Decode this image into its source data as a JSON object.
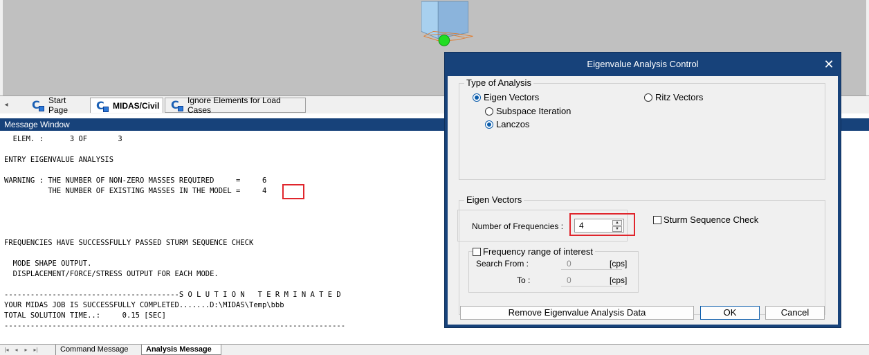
{
  "dialog": {
    "title": "Eigenvalue Analysis Control",
    "type_group_label": "Type of Analysis",
    "eigen_vectors_label": "Eigen Vectors",
    "ritz_vectors_label": "Ritz Vectors",
    "subspace_label": "Subspace Iteration",
    "lanczos_label": "Lanczos",
    "eigen_group_label": "Eigen Vectors",
    "num_freq_label": "Number of Frequencies :",
    "num_freq_value": "4",
    "sturm_label": "Sturm Sequence Check",
    "freq_range_label": "Frequency range of interest",
    "search_from_label": "Search From :",
    "search_from_value": "0",
    "to_label": "To :",
    "to_value": "0",
    "unit_cps": "[cps]",
    "remove_button": "Remove Eigenvalue Analysis Data",
    "ok_button": "OK",
    "cancel_button": "Cancel"
  },
  "tabs": {
    "start_page": "Start Page",
    "midas_civil": "MIDAS/Civil",
    "ignore_elements": "Ignore Elements for Load Cases"
  },
  "message_window": {
    "title": "Message Window",
    "lines": [
      "  ELEM. :      3 OF       3",
      "ENTRY EIGENVALUE ANALYSIS",
      "WARNING : THE NUMBER OF NON-ZERO MASSES REQUIRED     =     6",
      "          THE NUMBER OF EXISTING MASSES IN THE MODEL =     4",
      "FREQUENCIES HAVE SUCCESSFULLY PASSED STURM SEQUENCE CHECK",
      "  MODE SHAPE OUTPUT.",
      "  DISPLACEMENT/FORCE/STRESS OUTPUT FOR EACH MODE.",
      "----------------------------------------S O L U T I O N   T E R M I N A T E D",
      "YOUR MIDAS JOB IS SUCCESSFULLY COMPLETED.......D:\\MIDAS\\Temp\\bbb",
      "TOTAL SOLUTION TIME..:     0.15 [SEC]",
      "------------------------------------------------------------------------------"
    ]
  },
  "bottom_tabs": {
    "command_message": "Command Message",
    "analysis_message": "Analysis Message"
  },
  "colors": {
    "title_bar": "#17427a",
    "highlight": "#e0252c"
  }
}
